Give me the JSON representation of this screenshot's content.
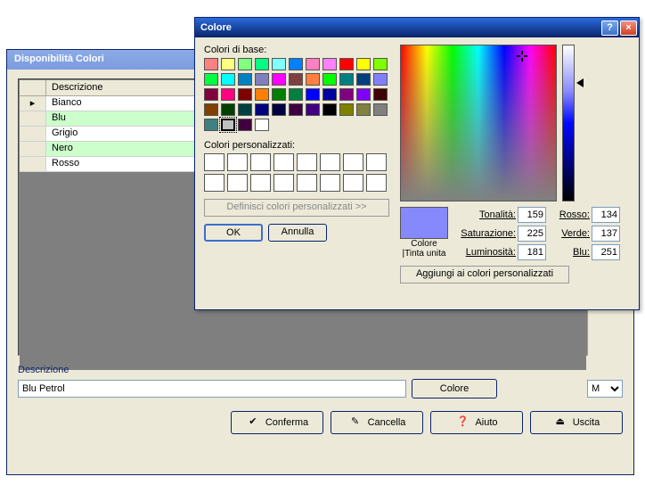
{
  "bg": {
    "title": "Disponibilità Colori",
    "header": "Descrizione",
    "rows": [
      "Bianco",
      "Blu",
      "Grigio",
      "Nero",
      "Rosso"
    ],
    "desc_label": "Descrizione",
    "desc_value": "Blu Petrol",
    "color_btn": "Colore",
    "dropdown": "M",
    "buttons": {
      "conferma": "Conferma",
      "cancella": "Cancella",
      "aiuto": "Aiuto",
      "uscita": "Uscita"
    }
  },
  "dlg": {
    "title": "Colore",
    "basic_label": "Colori di base:",
    "custom_label": "Colori personalizzati:",
    "define": "Definisci colori personalizzati >>",
    "ok": "OK",
    "cancel": "Annulla",
    "sample_label": "Colore |Tinta unita",
    "hue_l": "Tonalità:",
    "sat_l": "Saturazione:",
    "lum_l": "Luminosità:",
    "red_l": "Rosso:",
    "grn_l": "Verde:",
    "blu_l": "Blu:",
    "hue": "159",
    "sat": "225",
    "lum": "181",
    "red": "134",
    "grn": "137",
    "blu": "251",
    "add": "Aggiungi ai colori personalizzati",
    "basic_colors": [
      "#ff8080",
      "#ffff80",
      "#80ff80",
      "#00ff80",
      "#80ffff",
      "#0080ff",
      "#ff80c0",
      "#ff80ff",
      "#ff0000",
      "#ffff00",
      "#80ff00",
      "#00ff40",
      "#00ffff",
      "#0080c0",
      "#8080c0",
      "#ff00ff",
      "#804040",
      "#ff8040",
      "#00ff00",
      "#008080",
      "#004080",
      "#8080ff",
      "#800040",
      "#ff0080",
      "#800000",
      "#ff8000",
      "#008000",
      "#008040",
      "#0000ff",
      "#0000a0",
      "#800080",
      "#8000ff",
      "#400000",
      "#804000",
      "#004000",
      "#004040",
      "#000080",
      "#000040",
      "#400040",
      "#400080",
      "#000000",
      "#808000",
      "#808040",
      "#808080",
      "#408080",
      "#c0c0c0",
      "#400040",
      "#ffffff"
    ]
  }
}
